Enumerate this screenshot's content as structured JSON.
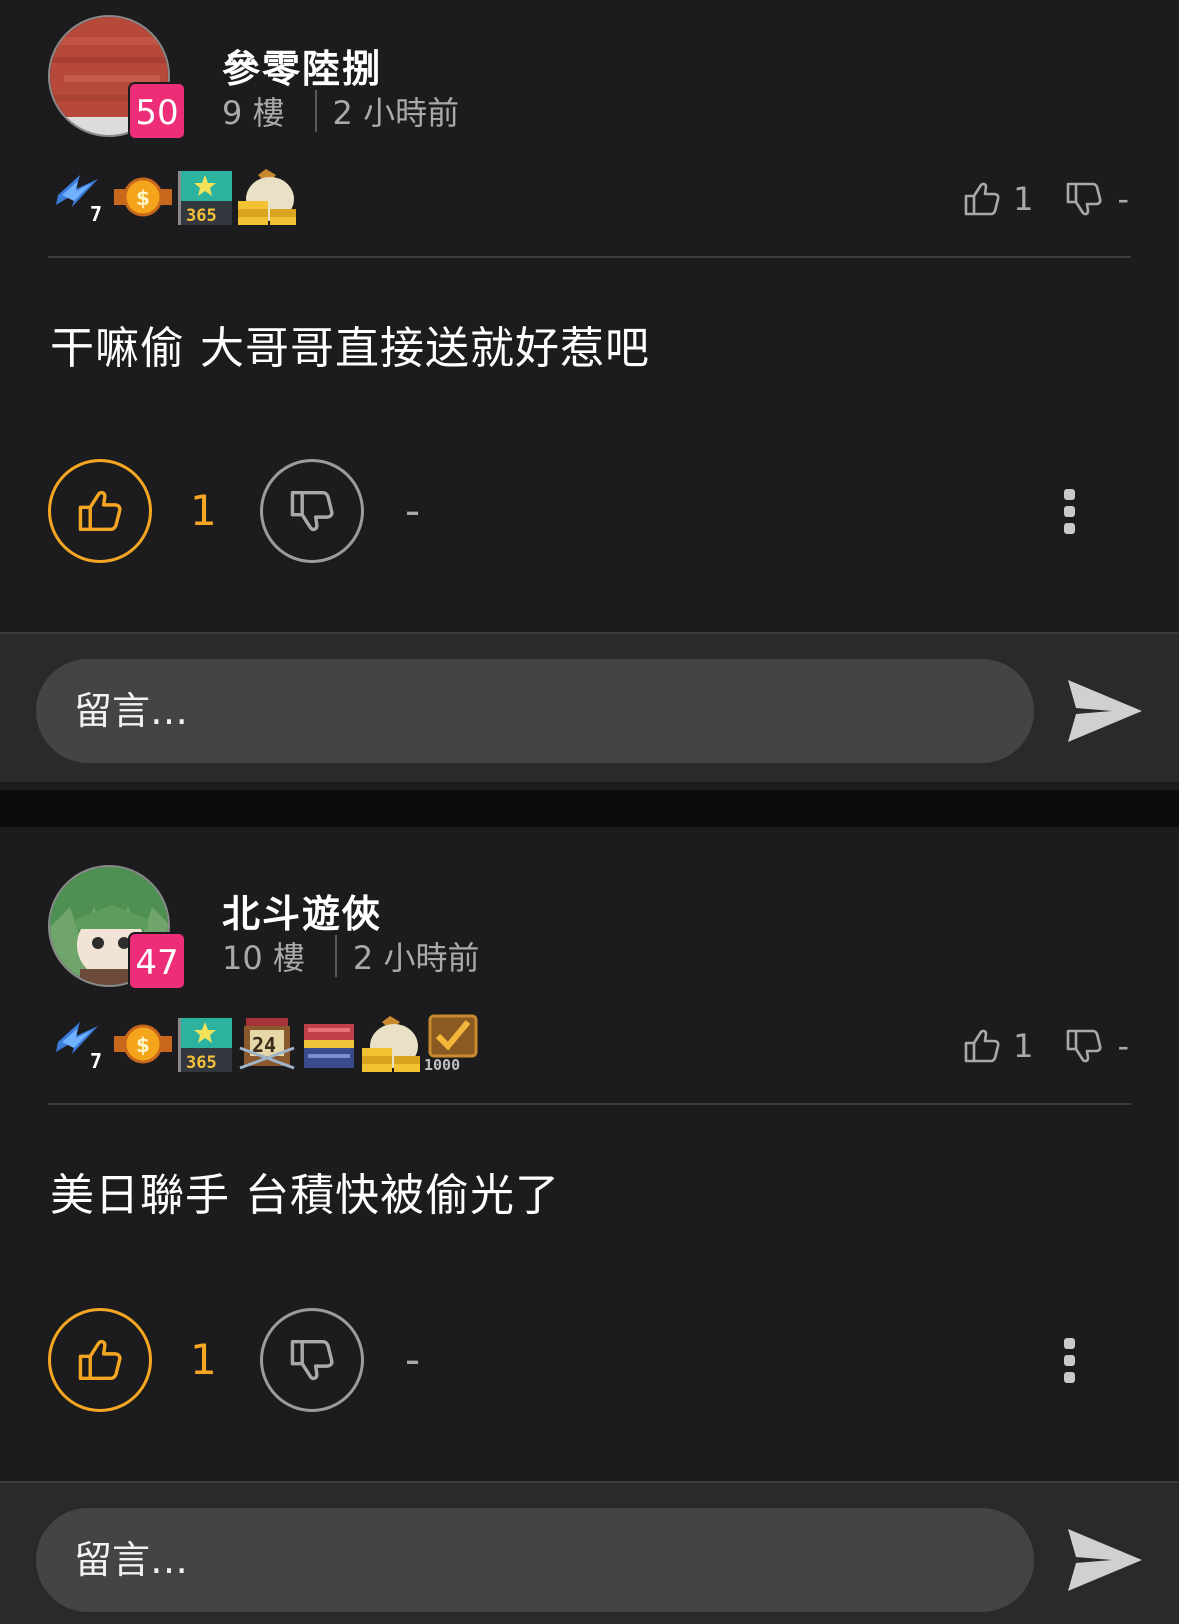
{
  "posts": [
    {
      "author": "參零陸捌",
      "level": "50",
      "floor": "9 樓",
      "time": "2 小時前",
      "badges": [
        "lightning-7-icon",
        "coin-icon",
        "flag-365-icon",
        "money-bag-icon"
      ],
      "mini_like": "1",
      "mini_dislike": "-",
      "content": "干嘛偷 大哥哥直接送就好惹吧",
      "like_count": "1",
      "dislike_count": "-",
      "comment_placeholder": "留言…"
    },
    {
      "author": "北斗遊俠",
      "level": "47",
      "floor": "10 樓",
      "time": "2 小時前",
      "badges": [
        "lightning-7-icon",
        "coin-icon",
        "flag-365-icon",
        "chest-24-icon",
        "treasure-box-icon",
        "money-bag-icon",
        "checkbox-1000-icon"
      ],
      "mini_like": "1",
      "mini_dislike": "-",
      "content": "美日聯手 台積快被偷光了",
      "like_count": "1",
      "dislike_count": "-",
      "comment_placeholder": "留言…"
    }
  ],
  "colors": {
    "background": "#1c1c1e",
    "accent_like": "#f5a623",
    "level_badge": "#ee2d78",
    "input_bg": "#444446"
  }
}
